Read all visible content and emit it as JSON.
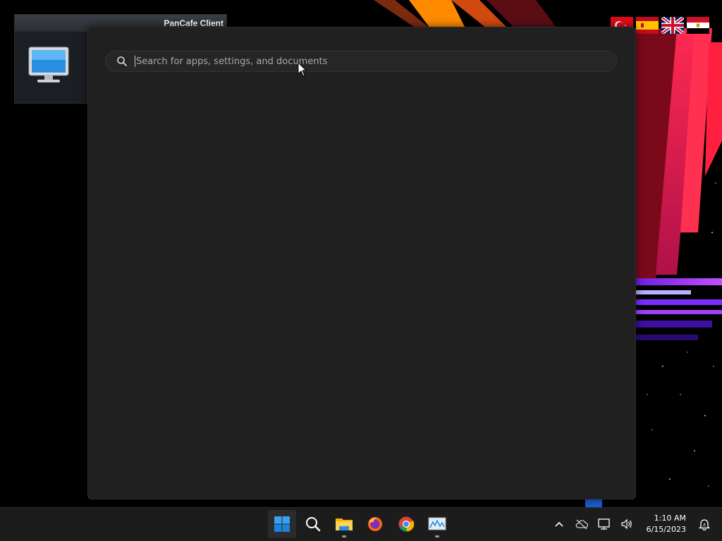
{
  "pancafe": {
    "title": "PanCafe Client"
  },
  "flags": [
    {
      "icon": "turkey-flag-icon"
    },
    {
      "icon": "spain-flag-icon"
    },
    {
      "icon": "uk-flag-icon"
    },
    {
      "icon": "egypt-flag-icon"
    }
  ],
  "start_menu": {
    "search": {
      "placeholder": "Search for apps, settings, and documents",
      "value": ""
    }
  },
  "taskbar": {
    "items": [
      {
        "name": "start",
        "icon": "windows-start-icon",
        "active": true
      },
      {
        "name": "search",
        "icon": "search-icon"
      },
      {
        "name": "file-explorer",
        "icon": "folder-icon",
        "running": true
      },
      {
        "name": "firefox",
        "icon": "firefox-icon"
      },
      {
        "name": "chrome",
        "icon": "chrome-icon"
      },
      {
        "name": "pancafe",
        "icon": "pancafe-app-icon",
        "running": true
      }
    ],
    "tray": {
      "time": "1:10 AM",
      "date": "6/15/2023"
    }
  },
  "colors": {
    "panel_bg": "#202020",
    "taskbar_bg": "#1c1c1c",
    "accent": "#0078d4"
  }
}
